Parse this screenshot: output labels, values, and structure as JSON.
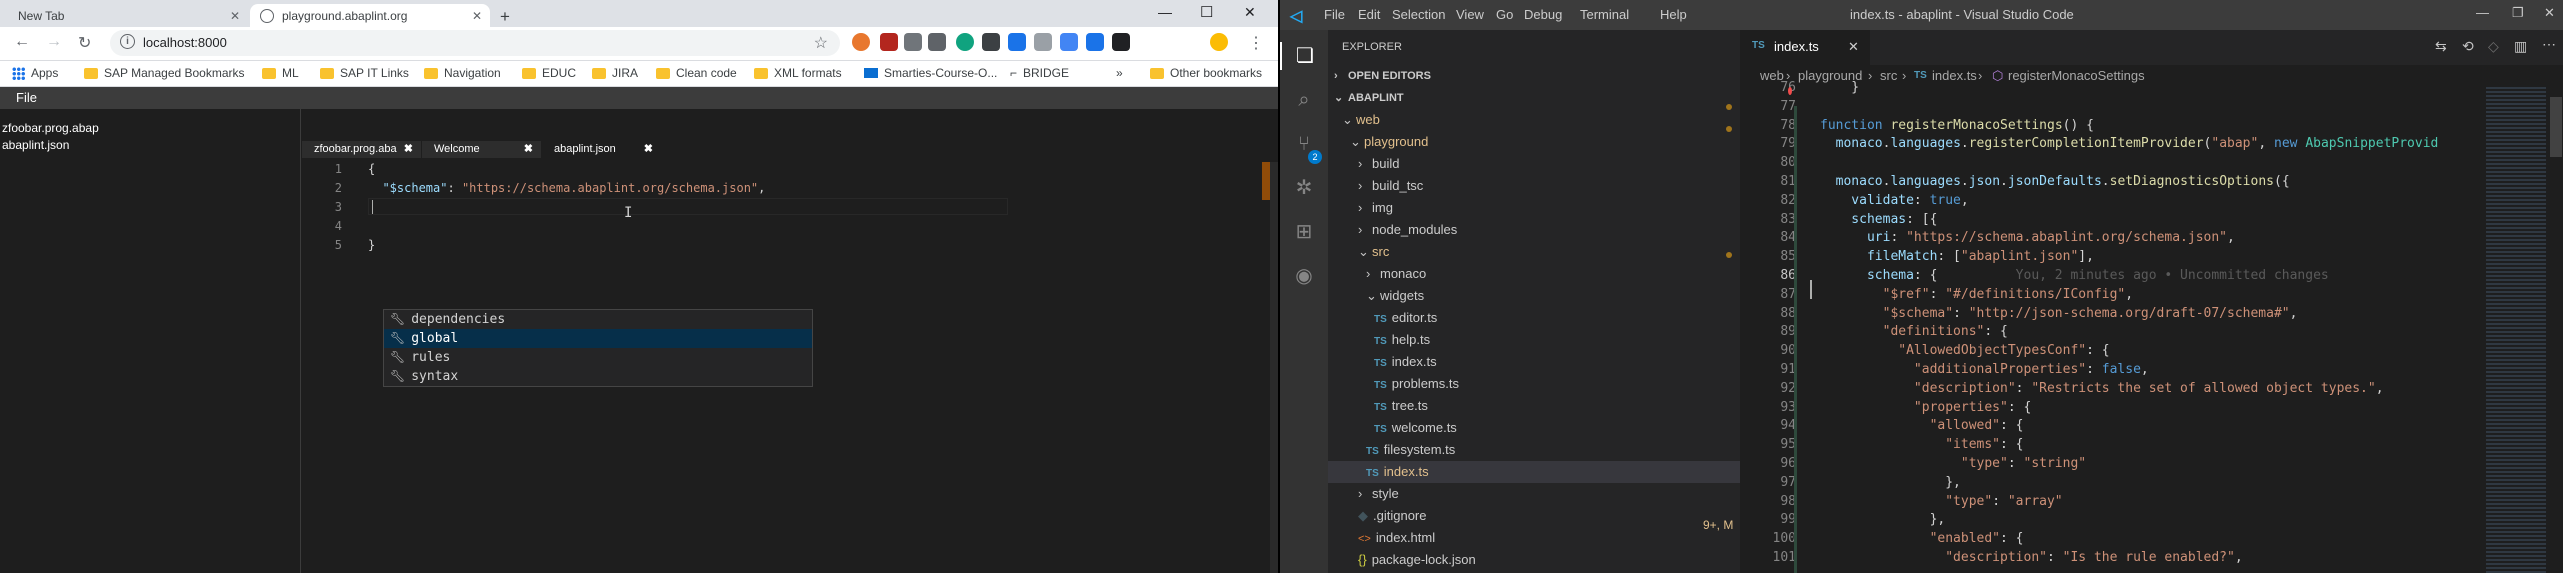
{
  "chrome": {
    "tabs": [
      {
        "title": "New Tab"
      },
      {
        "title": "playground.abaplint.org"
      }
    ],
    "address": "localhost:8000",
    "bookmarks": [
      {
        "label": "Apps",
        "type": "apps"
      },
      {
        "label": "SAP Managed Bookmarks",
        "type": "folder"
      },
      {
        "label": "ML",
        "type": "folder"
      },
      {
        "label": "SAP IT Links",
        "type": "folder"
      },
      {
        "label": "Navigation",
        "type": "folder"
      },
      {
        "label": "EDUC",
        "type": "folder"
      },
      {
        "label": "JIRA",
        "type": "folder"
      },
      {
        "label": "Clean code",
        "type": "folder"
      },
      {
        "label": "XML formats",
        "type": "folder"
      },
      {
        "label": "Smarties-Course-O...",
        "type": "sap"
      },
      {
        "label": "BRIDGE",
        "type": "link"
      }
    ],
    "bookmarks_more": "»",
    "other_bookmarks": "Other bookmarks"
  },
  "playground": {
    "menu": {
      "file": "File"
    },
    "files": [
      "zfoobar.prog.abap",
      "abaplint.json"
    ],
    "editor_tabs": [
      {
        "label": "zfoobar.prog.aba"
      },
      {
        "label": "Welcome"
      },
      {
        "label": "abaplint.json"
      }
    ],
    "lines": [
      {
        "num": "1",
        "text": "{"
      },
      {
        "num": "2",
        "key": "\"$schema\"",
        "colon": ": ",
        "value": "\"https://schema.abaplint.org/schema.json\"",
        "tail": ","
      },
      {
        "num": "3",
        "text": ""
      },
      {
        "num": "4",
        "text": ""
      },
      {
        "num": "5",
        "text": "}"
      }
    ],
    "suggestions": [
      "dependencies",
      "global",
      "rules",
      "syntax"
    ],
    "selected_suggestion": "global"
  },
  "vscode": {
    "title": "index.ts - abaplint - Visual Studio Code",
    "menu": [
      "File",
      "Edit",
      "Selection",
      "View",
      "Go",
      "Debug",
      "Terminal",
      "Help"
    ],
    "explorer": {
      "header": "EXPLORER",
      "open_editors": "OPEN EDITORS",
      "root": "ABAPLINT",
      "tree": [
        {
          "label": "web",
          "depth": 1,
          "kind": "open"
        },
        {
          "label": "playground",
          "depth": 2,
          "kind": "open"
        },
        {
          "label": "build",
          "depth": 3,
          "kind": "closed"
        },
        {
          "label": "build_tsc",
          "depth": 3,
          "kind": "closed"
        },
        {
          "label": "img",
          "depth": 3,
          "kind": "closed"
        },
        {
          "label": "node_modules",
          "depth": 3,
          "kind": "closed"
        },
        {
          "label": "src",
          "depth": 3,
          "kind": "open"
        },
        {
          "label": "monaco",
          "depth": 4,
          "kind": "closed"
        },
        {
          "label": "widgets",
          "depth": 4,
          "kind": "open"
        },
        {
          "label": "editor.ts",
          "depth": 5,
          "kind": "ts"
        },
        {
          "label": "help.ts",
          "depth": 5,
          "kind": "ts"
        },
        {
          "label": "index.ts",
          "depth": 5,
          "kind": "ts"
        },
        {
          "label": "problems.ts",
          "depth": 5,
          "kind": "ts"
        },
        {
          "label": "tree.ts",
          "depth": 5,
          "kind": "ts"
        },
        {
          "label": "welcome.ts",
          "depth": 5,
          "kind": "ts"
        },
        {
          "label": "filesystem.ts",
          "depth": 4,
          "kind": "ts"
        },
        {
          "label": "index.ts",
          "depth": 4,
          "kind": "ts-active"
        },
        {
          "label": "style",
          "depth": 3,
          "kind": "closed"
        },
        {
          "label": ".gitignore",
          "depth": 3,
          "kind": "git"
        },
        {
          "label": "index.html",
          "depth": 3,
          "kind": "html"
        },
        {
          "label": "package-lock.json",
          "depth": 3,
          "kind": "json"
        }
      ],
      "active_badge": "9+, M"
    },
    "tab": "index.ts",
    "breadcrumbs": [
      "web",
      "playground",
      "src",
      "index.ts",
      "registerMonacoSettings"
    ],
    "code_lines": [
      {
        "num": "76",
        "segs": [
          {
            "t": "    }",
            "c": "p"
          }
        ]
      },
      {
        "num": "77",
        "segs": []
      },
      {
        "num": "78",
        "segs": [
          {
            "t": "function ",
            "c": "kw"
          },
          {
            "t": "registerMonacoSettings",
            "c": "fn"
          },
          {
            "t": "() {",
            "c": "p"
          }
        ]
      },
      {
        "num": "79",
        "segs": [
          {
            "t": "  monaco",
            "c": "var"
          },
          {
            "t": ".",
            "c": "p"
          },
          {
            "t": "languages",
            "c": "var"
          },
          {
            "t": ".",
            "c": "p"
          },
          {
            "t": "registerCompletionItemProvider",
            "c": "fn"
          },
          {
            "t": "(",
            "c": "p"
          },
          {
            "t": "\"abap\"",
            "c": "str"
          },
          {
            "t": ", ",
            "c": "p"
          },
          {
            "t": "new ",
            "c": "kw"
          },
          {
            "t": "AbapSnippetProvid",
            "c": "ty"
          }
        ]
      },
      {
        "num": "80",
        "segs": []
      },
      {
        "num": "81",
        "segs": [
          {
            "t": "  monaco",
            "c": "var"
          },
          {
            "t": ".",
            "c": "p"
          },
          {
            "t": "languages",
            "c": "var"
          },
          {
            "t": ".",
            "c": "p"
          },
          {
            "t": "json",
            "c": "var"
          },
          {
            "t": ".",
            "c": "p"
          },
          {
            "t": "jsonDefaults",
            "c": "var"
          },
          {
            "t": ".",
            "c": "p"
          },
          {
            "t": "setDiagnosticsOptions",
            "c": "fn"
          },
          {
            "t": "({",
            "c": "p"
          }
        ]
      },
      {
        "num": "82",
        "segs": [
          {
            "t": "    validate",
            "c": "var"
          },
          {
            "t": ": ",
            "c": "p"
          },
          {
            "t": "true",
            "c": "bl"
          },
          {
            "t": ",",
            "c": "p"
          }
        ]
      },
      {
        "num": "83",
        "segs": [
          {
            "t": "    schemas",
            "c": "var"
          },
          {
            "t": ": [{",
            "c": "p"
          }
        ]
      },
      {
        "num": "84",
        "segs": [
          {
            "t": "      uri",
            "c": "var"
          },
          {
            "t": ": ",
            "c": "p"
          },
          {
            "t": "\"https://schema.abaplint.org/schema.json\"",
            "c": "str"
          },
          {
            "t": ",",
            "c": "p"
          }
        ]
      },
      {
        "num": "85",
        "segs": [
          {
            "t": "      fileMatch",
            "c": "var"
          },
          {
            "t": ": [",
            "c": "p"
          },
          {
            "t": "\"abaplint.json\"",
            "c": "str"
          },
          {
            "t": "],",
            "c": "p"
          }
        ]
      },
      {
        "num": "86",
        "segs": [
          {
            "t": "      schema",
            "c": "var"
          },
          {
            "t": ": {",
            "c": "p"
          },
          {
            "t": "          You, 2 minutes ago • Uncommitted changes",
            "c": "blame"
          }
        ]
      },
      {
        "num": "87",
        "segs": [
          {
            "t": "        \"$ref\"",
            "c": "str"
          },
          {
            "t": ": ",
            "c": "p"
          },
          {
            "t": "\"#/definitions/IConfig\"",
            "c": "str"
          },
          {
            "t": ",",
            "c": "p"
          }
        ]
      },
      {
        "num": "88",
        "segs": [
          {
            "t": "        \"$schema\"",
            "c": "str"
          },
          {
            "t": ": ",
            "c": "p"
          },
          {
            "t": "\"http://json-schema.org/draft-07/schema#\"",
            "c": "str"
          },
          {
            "t": ",",
            "c": "p"
          }
        ]
      },
      {
        "num": "89",
        "segs": [
          {
            "t": "        \"definitions\"",
            "c": "str"
          },
          {
            "t": ": {",
            "c": "p"
          }
        ]
      },
      {
        "num": "90",
        "segs": [
          {
            "t": "          \"AllowedObjectTypesConf\"",
            "c": "str"
          },
          {
            "t": ": {",
            "c": "p"
          }
        ]
      },
      {
        "num": "91",
        "segs": [
          {
            "t": "            \"additionalProperties\"",
            "c": "str"
          },
          {
            "t": ": ",
            "c": "p"
          },
          {
            "t": "false",
            "c": "bl"
          },
          {
            "t": ",",
            "c": "p"
          }
        ]
      },
      {
        "num": "92",
        "segs": [
          {
            "t": "            \"description\"",
            "c": "str"
          },
          {
            "t": ": ",
            "c": "p"
          },
          {
            "t": "\"Restricts the set of allowed object types.\"",
            "c": "str"
          },
          {
            "t": ",",
            "c": "p"
          }
        ]
      },
      {
        "num": "93",
        "segs": [
          {
            "t": "            \"properties\"",
            "c": "str"
          },
          {
            "t": ": {",
            "c": "p"
          }
        ]
      },
      {
        "num": "94",
        "segs": [
          {
            "t": "              \"allowed\"",
            "c": "str"
          },
          {
            "t": ": {",
            "c": "p"
          }
        ]
      },
      {
        "num": "95",
        "segs": [
          {
            "t": "                \"items\"",
            "c": "str"
          },
          {
            "t": ": {",
            "c": "p"
          }
        ]
      },
      {
        "num": "96",
        "segs": [
          {
            "t": "                  \"type\"",
            "c": "str"
          },
          {
            "t": ": ",
            "c": "p"
          },
          {
            "t": "\"string\"",
            "c": "str"
          }
        ]
      },
      {
        "num": "97",
        "segs": [
          {
            "t": "                },",
            "c": "p"
          }
        ]
      },
      {
        "num": "98",
        "segs": [
          {
            "t": "                \"type\"",
            "c": "str"
          },
          {
            "t": ": ",
            "c": "p"
          },
          {
            "t": "\"array\"",
            "c": "str"
          }
        ]
      },
      {
        "num": "99",
        "segs": [
          {
            "t": "              },",
            "c": "p"
          }
        ]
      },
      {
        "num": "100",
        "segs": [
          {
            "t": "              \"enabled\"",
            "c": "str"
          },
          {
            "t": ": {",
            "c": "p"
          }
        ]
      },
      {
        "num": "101",
        "segs": [
          {
            "t": "                \"description\"",
            "c": "str"
          },
          {
            "t": ": ",
            "c": "p"
          },
          {
            "t": "\"Is the rule enabled?\"",
            "c": "str"
          },
          {
            "t": ",",
            "c": "p"
          }
        ]
      }
    ],
    "current_line": "86"
  }
}
